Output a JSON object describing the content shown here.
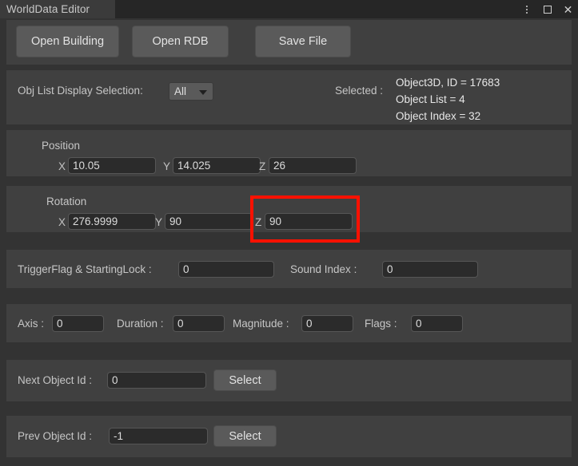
{
  "window": {
    "tab_label": "WorldData Editor",
    "controls": [
      {
        "name": "more-options",
        "glyph": "kebab"
      },
      {
        "name": "maximize",
        "glyph": "square"
      },
      {
        "name": "close",
        "glyph": "×"
      }
    ]
  },
  "toolbar": {
    "open_building_label": "Open Building",
    "open_rdb_label": "Open RDB",
    "save_file_label": "Save File"
  },
  "selection": {
    "display_selection_label": "Obj List Display Selection:",
    "display_selection_value": "All",
    "display_selection_options": [
      "All"
    ],
    "selected_label": "Selected :",
    "info_line_1": "Object3D, ID = 17683",
    "info_line_2": "Object List = 4",
    "info_line_3": "Object Index = 32"
  },
  "position": {
    "title": "Position",
    "x_label": "X",
    "x_value": "10.05",
    "y_label": "Y",
    "y_value": "14.025",
    "z_label": "Z",
    "z_value": "26"
  },
  "rotation": {
    "title": "Rotation",
    "x_label": "X",
    "x_value": "276.9999",
    "y_label": "Y",
    "y_value": "90",
    "z_label": "Z",
    "z_value": "90",
    "highlight_color": "#ff1100"
  },
  "trigger": {
    "trigger_label": "TriggerFlag & StartingLock :",
    "trigger_value": "0",
    "sound_label": "Sound Index :",
    "sound_value": "0"
  },
  "motion": {
    "axis_label": "Axis :",
    "axis_value": "0",
    "duration_label": "Duration :",
    "duration_value": "0",
    "magnitude_label": "Magnitude :",
    "magnitude_value": "0",
    "flags_label": "Flags :",
    "flags_value": "0"
  },
  "next_object": {
    "label": "Next Object Id :",
    "value": "0",
    "select_label": "Select"
  },
  "prev_object": {
    "label": "Prev Object Id :",
    "value": "-1",
    "select_label": "Select"
  },
  "theme": {
    "window_bg": "#333333",
    "panel_bg": "#404040",
    "titlebar_bg": "#262626",
    "tab_bg": "#3b3b3b",
    "field_bg": "#2b2b2b",
    "button_bg": "#5a5a5a"
  }
}
